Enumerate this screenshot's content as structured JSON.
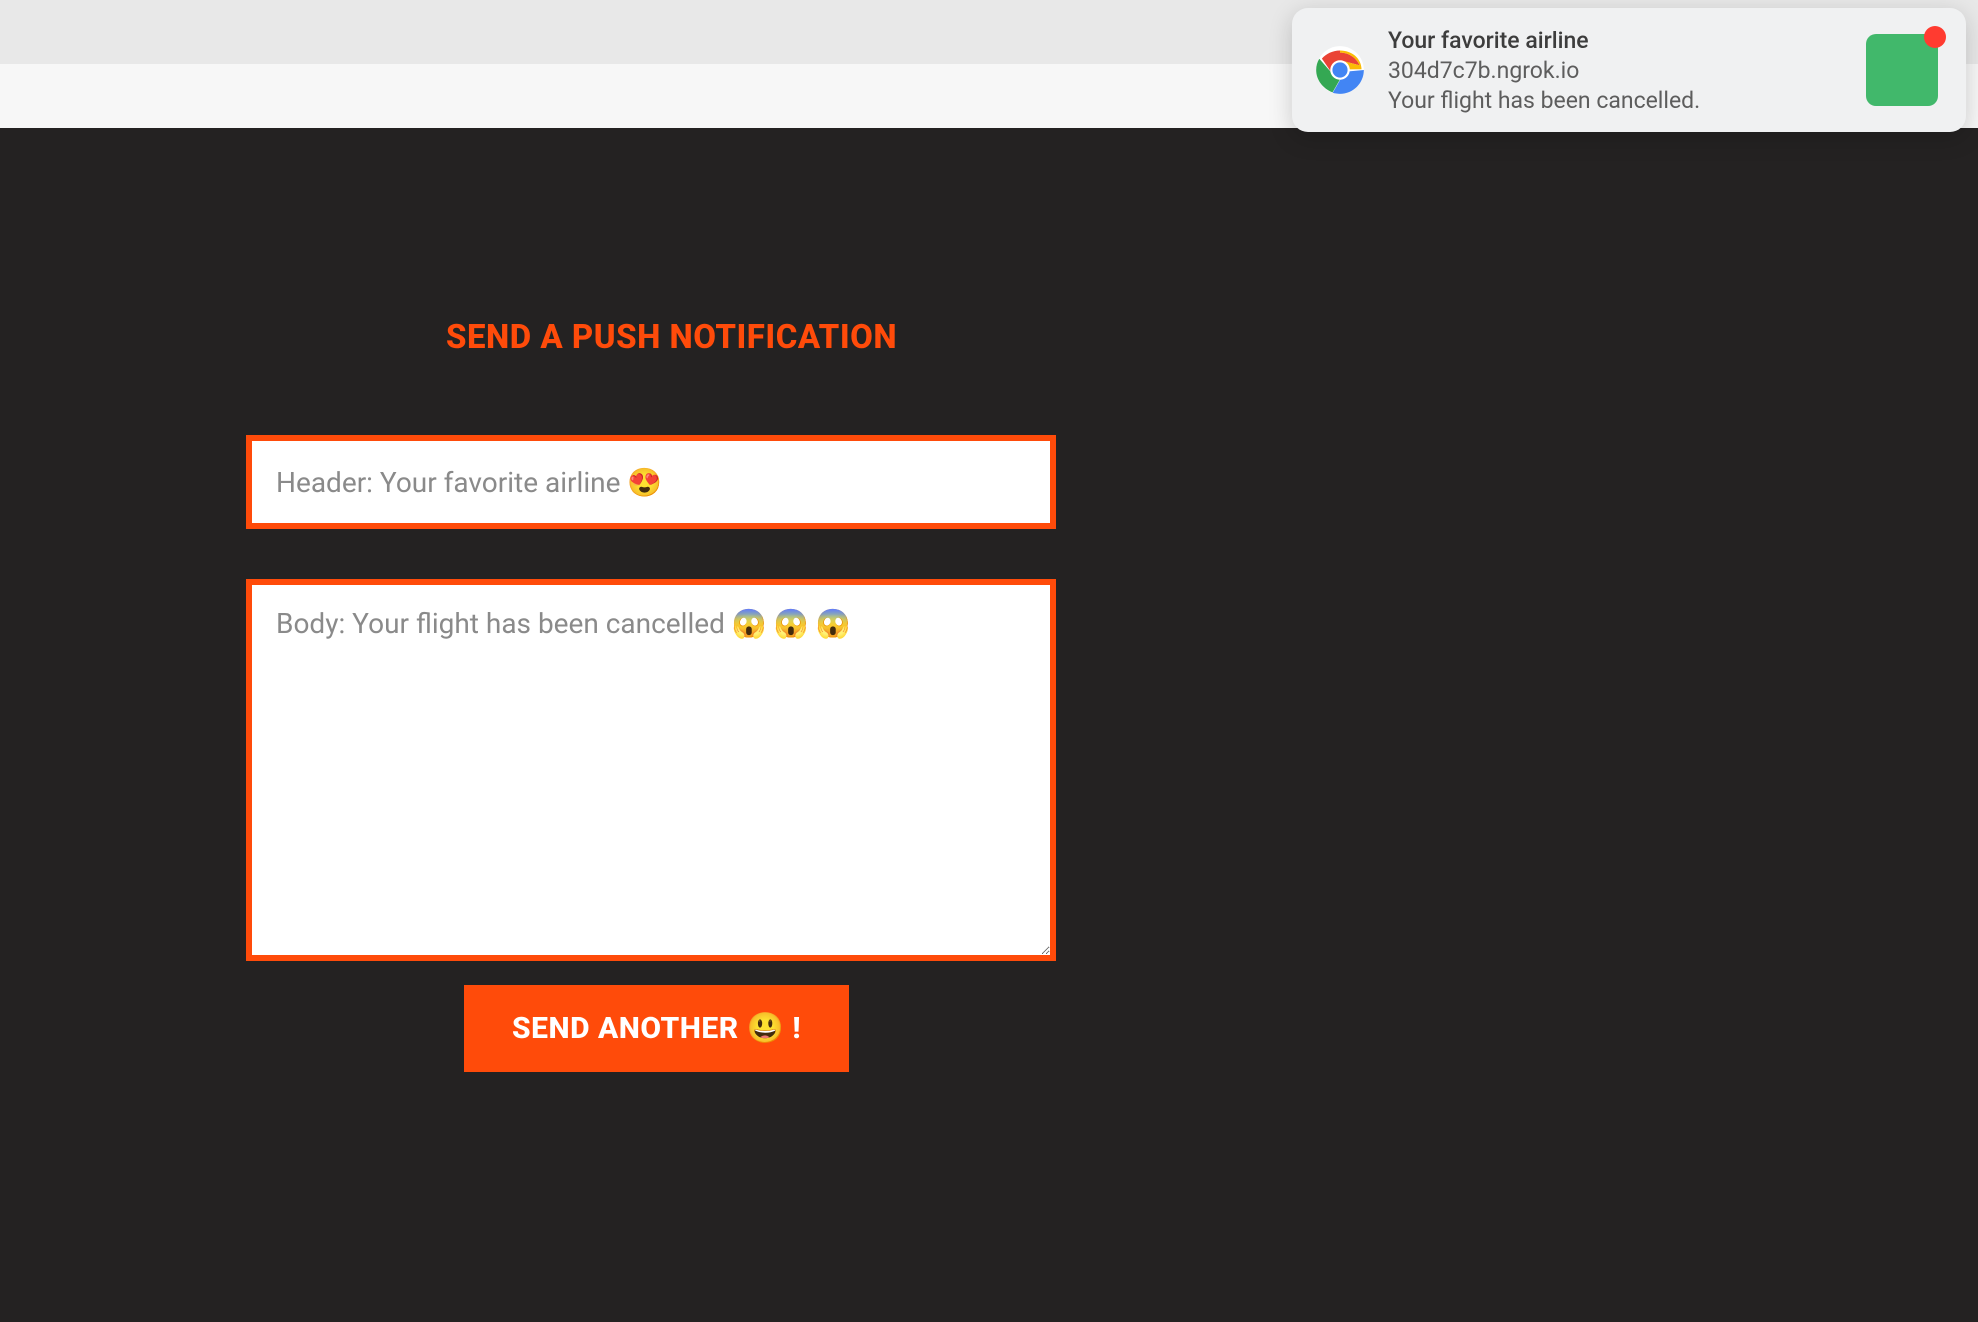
{
  "page": {
    "title": "SEND A PUSH NOTIFICATION",
    "header_input": {
      "placeholder": "Header: Your favorite airline 😍",
      "value": ""
    },
    "body_input": {
      "placeholder": "Body: Your flight has been cancelled 😱 😱 😱",
      "value": ""
    },
    "send_button_label": "SEND ANOTHER 😃 !"
  },
  "notification": {
    "title": "Your favorite airline",
    "origin": "304d7c7b.ngrok.io",
    "body": "Your flight has been cancelled.",
    "app_icon_color": "#41b86b",
    "badge": true
  }
}
